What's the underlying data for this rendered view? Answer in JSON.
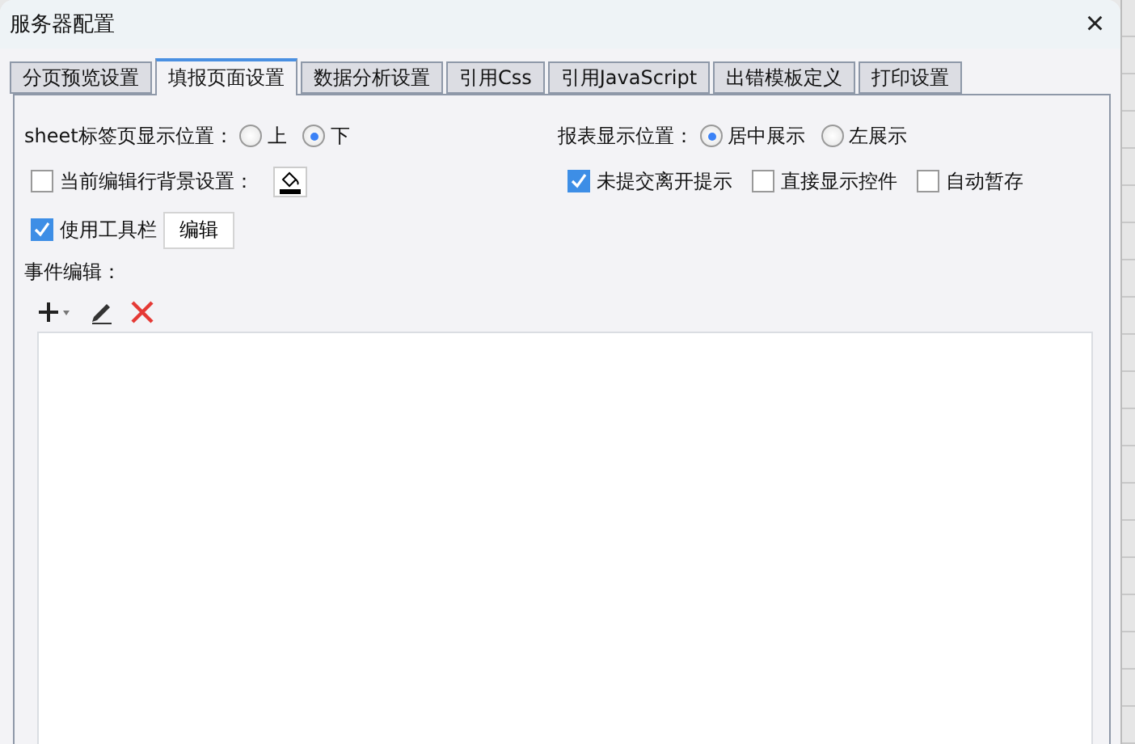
{
  "window": {
    "title": "服务器配置",
    "close": "×"
  },
  "tabs": [
    {
      "label": "分页预览设置",
      "selected": false
    },
    {
      "label": "填报页面设置",
      "selected": true
    },
    {
      "label": "数据分析设置",
      "selected": false
    },
    {
      "label": "引用Css",
      "selected": false
    },
    {
      "label": "引用JavaScript",
      "selected": false
    },
    {
      "label": "出错模板定义",
      "selected": false
    },
    {
      "label": "打印设置",
      "selected": false
    }
  ],
  "sheet_position": {
    "label": "sheet标签页显示位置：",
    "options": [
      {
        "label": "上",
        "selected": false
      },
      {
        "label": "下",
        "selected": true
      }
    ]
  },
  "report_position": {
    "label": "报表显示位置：",
    "options": [
      {
        "label": "居中展示",
        "selected": true
      },
      {
        "label": "左展示",
        "selected": false
      }
    ]
  },
  "row_background": {
    "label": "当前编辑行背景设置：",
    "checked": false
  },
  "options": [
    {
      "label": "未提交离开提示",
      "checked": true
    },
    {
      "label": "直接显示控件",
      "checked": false
    },
    {
      "label": "自动暂存",
      "checked": false
    }
  ],
  "toolbar": {
    "label": "使用工具栏",
    "checked": true,
    "button": "编辑"
  },
  "events": {
    "label": "事件编辑："
  }
}
